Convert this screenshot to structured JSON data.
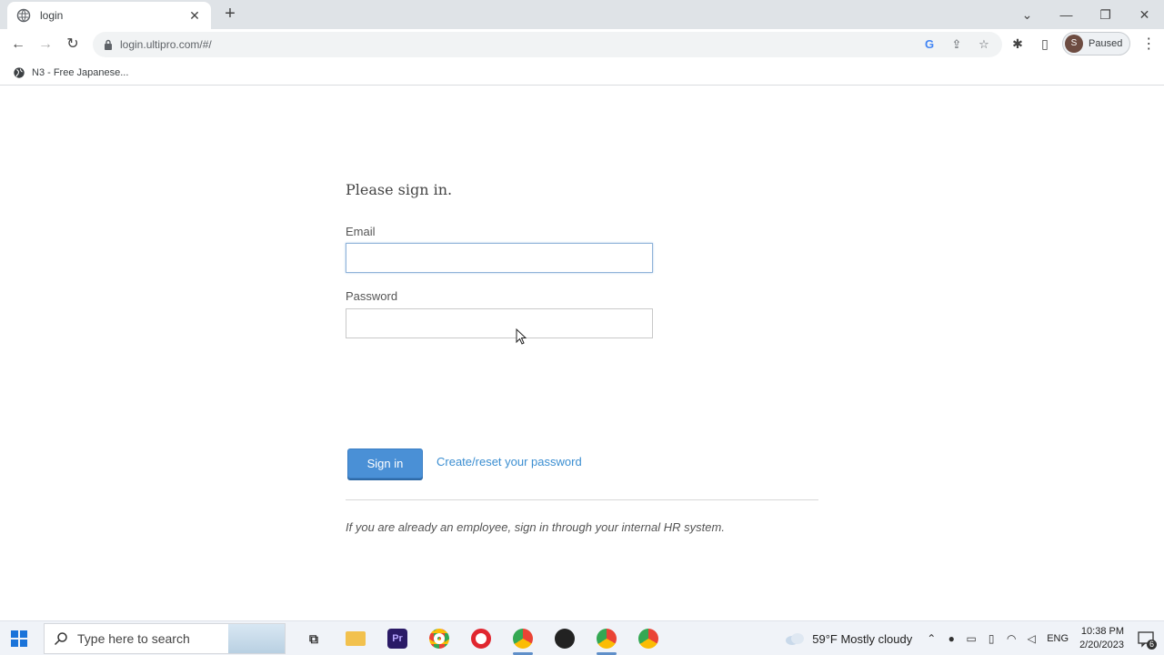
{
  "browser": {
    "tab": {
      "title": "login"
    },
    "url": "login.ultipro.com/#/",
    "profile_status": "Paused",
    "profile_initial": "S",
    "bookmark": {
      "label": "N3 - Free Japanese..."
    }
  },
  "signin": {
    "heading": "Please sign in.",
    "email_label": "Email",
    "email_value": "",
    "password_label": "Password",
    "password_value": "",
    "submit_label": "Sign in",
    "reset_link": "Create/reset your password",
    "note": "If you are already an employee, sign in through your internal HR system."
  },
  "taskbar": {
    "search_placeholder": "Type here to search",
    "weather": "59°F  Mostly cloudy",
    "language": "ENG",
    "time": "10:38 PM",
    "date": "2/20/2023",
    "notification_count": "6",
    "premiere_label": "Pr"
  },
  "colors": {
    "primary_button": "#4a90d6",
    "link": "#3b8ed1"
  }
}
